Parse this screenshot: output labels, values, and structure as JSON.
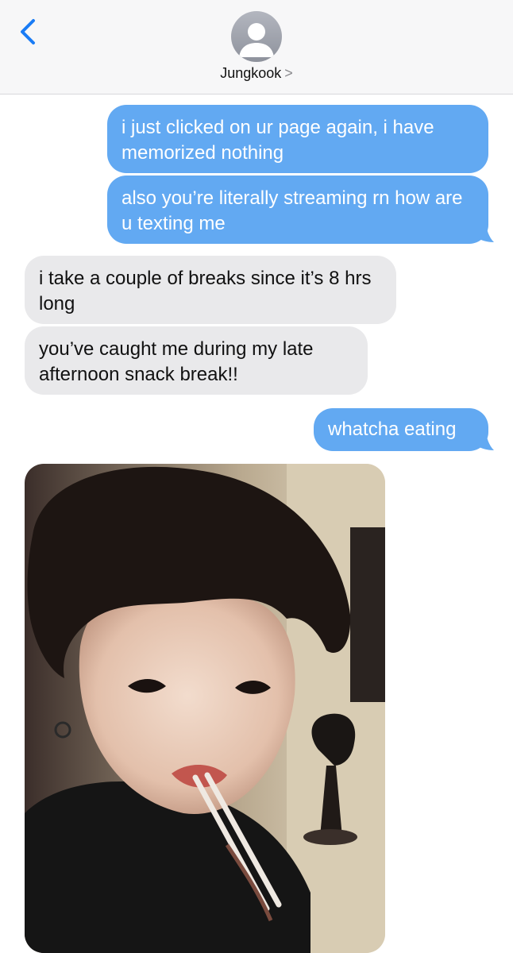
{
  "header": {
    "back_icon": "chevron-left-icon",
    "avatar_icon": "person-silhouette-icon",
    "contact_name": "Jungkook",
    "contact_chevron": ">"
  },
  "messages": [
    {
      "direction": "sent",
      "text": "i just clicked on ur page again, i have memorized nothing"
    },
    {
      "direction": "sent",
      "text": "also you’re literally streaming rn how are u texting me"
    },
    {
      "direction": "received",
      "text": "i take a couple of breaks since it’s 8 hrs long"
    },
    {
      "direction": "received",
      "text": "you’ve caught me during my late afternoon snack break!!"
    },
    {
      "direction": "sent",
      "text": "whatcha eating"
    },
    {
      "direction": "received",
      "type": "photo",
      "subject": "selfie eating with chopsticks"
    }
  ],
  "colors": {
    "sent_bubble": "#62a9f2",
    "received_bubble": "#e9e9eb",
    "accent": "#1a7cf5"
  }
}
